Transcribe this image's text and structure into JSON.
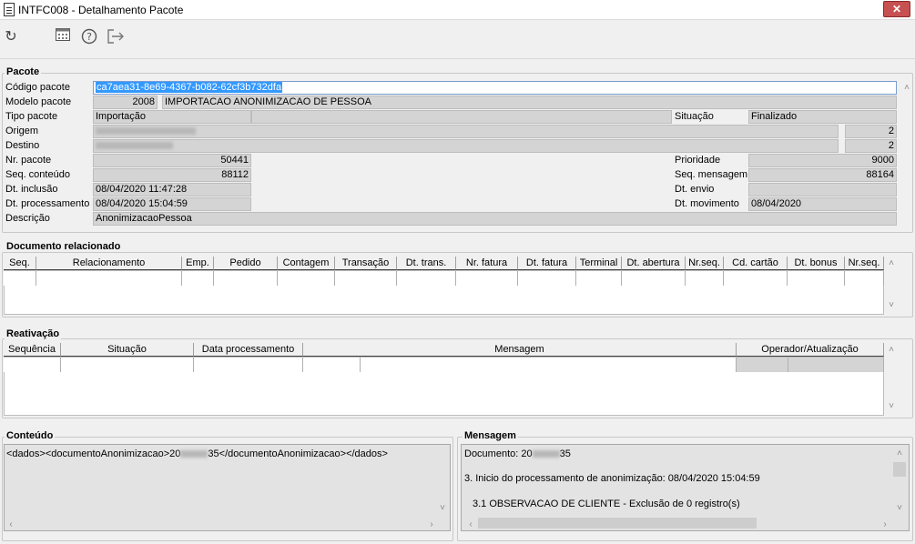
{
  "window": {
    "title": "INTFC008 - Detalhamento Pacote",
    "close_label": "✕"
  },
  "toolbar": {
    "icons": [
      "refresh-icon",
      "calculator-icon",
      "help-icon",
      "exit-icon"
    ]
  },
  "pacote": {
    "legend": "Pacote",
    "codigo_label": "Código pacote",
    "codigo_value": "ca7aea31-8e69-4367-b082-62cf3b732dfa",
    "modelo_label": "Modelo pacote",
    "modelo_code": "2008",
    "modelo_desc": "IMPORTACAO ANONIMIZACAO DE PESSOA",
    "tipo_label": "Tipo pacote",
    "tipo_value": "Importação",
    "situacao_label": "Situação",
    "situacao_value": "Finalizado",
    "origem_label": "Origem",
    "origem_num": "2",
    "destino_label": "Destino",
    "destino_num": "2",
    "nr_label": "Nr. pacote",
    "nr_value": "50441",
    "prioridade_label": "Prioridade",
    "prioridade_value": "9000",
    "seqconteudo_label": "Seq. conteúdo",
    "seqconteudo_value": "88112",
    "seqmensagem_label": "Seq. mensagem",
    "seqmensagem_value": "88164",
    "dtinclusao_label": "Dt. inclusão",
    "dtinclusao_value": "08/04/2020 11:47:28",
    "dtenvio_label": "Dt. envio",
    "dtenvio_value": "",
    "dtprocessamento_label": "Dt. processamento",
    "dtprocessamento_value": "08/04/2020 15:04:59",
    "dtmovimento_label": "Dt. movimento",
    "dtmovimento_value": "08/04/2020",
    "descricao_label": "Descrição",
    "descricao_value": "AnonimizacaoPessoa"
  },
  "documento": {
    "legend": "Documento relacionado",
    "columns": [
      "Seq.",
      "Relacionamento",
      "Emp.",
      "Pedido",
      "Contagem",
      "Transação",
      "Dt. trans.",
      "Nr. fatura",
      "Dt. fatura",
      "Terminal",
      "Dt. abertura",
      "Nr.seq.",
      "Cd. cartão",
      "Dt. bonus",
      "Nr.seq."
    ]
  },
  "reativacao": {
    "legend": "Reativação",
    "columns": [
      "Sequência",
      "Situação",
      "Data processamento",
      "Mensagem",
      "Operador/Atualização"
    ]
  },
  "conteudo": {
    "legend": "Conteúdo",
    "text_prefix": "<dados><documentoAnonimizacao>20",
    "text_suffix": "35</documentoAnonimizacao></dados>"
  },
  "mensagem": {
    "legend": "Mensagem",
    "line1_prefix": "Documento: 20",
    "line1_suffix": "35",
    "line2": "3. Inicio do processamento de anonimização: 08/04/2020 15:04:59",
    "line3": "3.1 OBSERVACAO DE CLIENTE - Exclusão de 0 registro(s)"
  },
  "colors": {
    "accent_selection": "#3399ff",
    "close_button": "#c75050",
    "field_bg": "#d4d4d4"
  }
}
